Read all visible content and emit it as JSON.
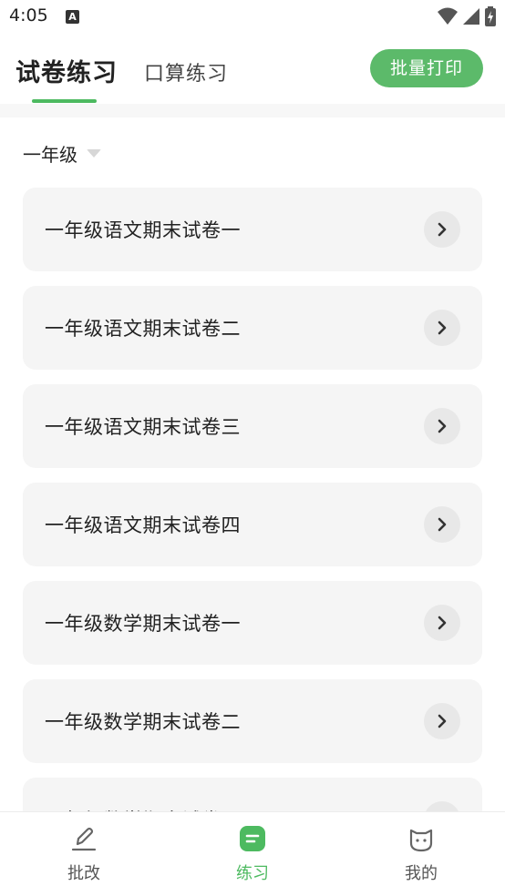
{
  "status_bar": {
    "time": "4:05"
  },
  "header": {
    "tab_active": "试卷练习",
    "tab_inactive": "口算练习",
    "print_button": "批量打印"
  },
  "grade_selector": {
    "label": "一年级"
  },
  "papers": [
    {
      "title": "一年级语文期末试卷一"
    },
    {
      "title": "一年级语文期末试卷二"
    },
    {
      "title": "一年级语文期末试卷三"
    },
    {
      "title": "一年级语文期末试卷四"
    },
    {
      "title": "一年级数学期末试卷一"
    },
    {
      "title": "一年级数学期末试卷二"
    },
    {
      "title": "一年级数学期末试卷三"
    }
  ],
  "bottom_nav": {
    "items": [
      {
        "label": "批改",
        "icon": "pencil-icon",
        "active": false
      },
      {
        "label": "练习",
        "icon": "practice-icon",
        "active": true
      },
      {
        "label": "我的",
        "icon": "cat-face-icon",
        "active": false
      }
    ]
  },
  "colors": {
    "accent": "#4dba60",
    "button": "#5cba6a",
    "card_bg": "#f5f5f5"
  }
}
